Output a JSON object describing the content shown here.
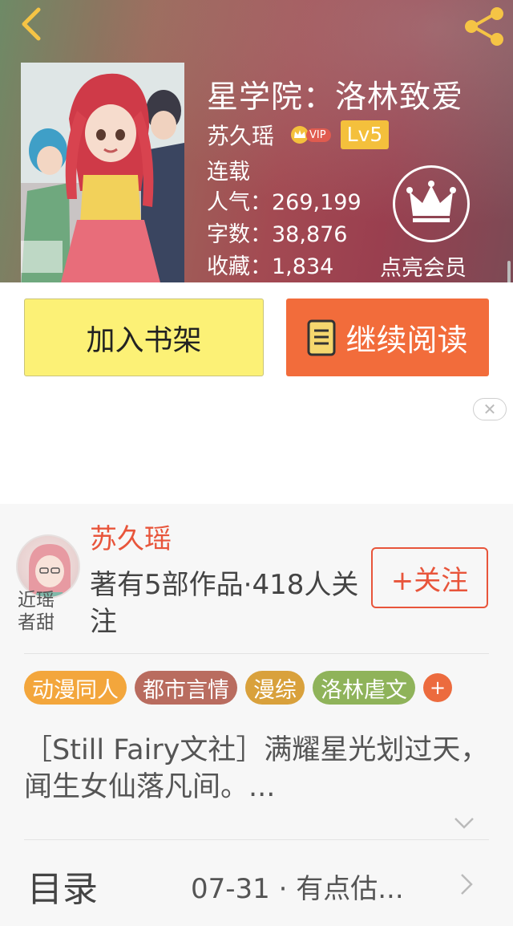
{
  "book": {
    "title": "星学院：洛林致爱",
    "author": "苏久瑶",
    "vip_label": "VIP",
    "level": "Lv5",
    "status": "连载",
    "popularity": "人气：269,199",
    "word_count": "字数：38,876",
    "favorites": "收藏：1,834"
  },
  "member": {
    "label": "点亮会员"
  },
  "actions": {
    "add_shelf": "加入书架",
    "continue_read": "继续阅读"
  },
  "author_profile": {
    "name": "苏久瑶",
    "stats": "著有5部作品·418人关注",
    "follow": "+关注",
    "avatar_caption": "近瑶者甜"
  },
  "tags": [
    {
      "label": "动漫同人",
      "color": "#f3a63c"
    },
    {
      "label": "都市言情",
      "color": "#b96c5f"
    },
    {
      "label": "漫综",
      "color": "#d9a13c"
    },
    {
      "label": "洛林虐文",
      "color": "#8fb35a"
    }
  ],
  "tag_add": "+",
  "intro": "［Still Fairy文社］满耀星光划过天，闻生女仙落凡间。...",
  "toc": {
    "label": "目录",
    "latest": "07-31 · 有点估..."
  },
  "colors": {
    "accent": "#e8553b",
    "shelf_button": "#fcf176",
    "read_button": "#f26c3b",
    "level_badge": "#f4c03c"
  }
}
